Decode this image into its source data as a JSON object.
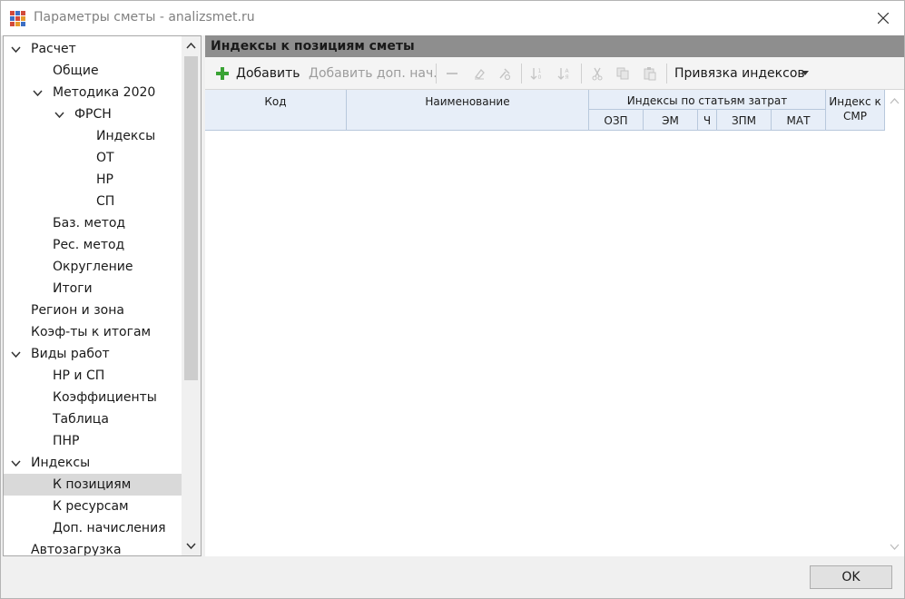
{
  "window": {
    "title": "Параметры сметы - analizsmet.ru"
  },
  "tree": {
    "items": [
      {
        "label": "Расчет",
        "expanded": true
      },
      {
        "label": "Общие"
      },
      {
        "label": "Методика 2020",
        "expanded": true
      },
      {
        "label": "ФРСН",
        "expanded": true
      },
      {
        "label": "Индексы"
      },
      {
        "label": "ОТ"
      },
      {
        "label": "НР"
      },
      {
        "label": "СП"
      },
      {
        "label": "Баз. метод"
      },
      {
        "label": "Рес. метод"
      },
      {
        "label": "Округление"
      },
      {
        "label": "Итоги"
      },
      {
        "label": "Регион и зона"
      },
      {
        "label": "Коэф-ты к итогам"
      },
      {
        "label": "Виды работ",
        "expanded": true
      },
      {
        "label": "НР и СП"
      },
      {
        "label": "Коэффициенты"
      },
      {
        "label": "Таблица"
      },
      {
        "label": "ПНР"
      },
      {
        "label": "Индексы",
        "expanded": true
      },
      {
        "label": "К позициям",
        "selected": true
      },
      {
        "label": "К ресурсам"
      },
      {
        "label": "Доп. начисления"
      },
      {
        "label": "Автозагрузка"
      }
    ]
  },
  "panel": {
    "header": "Индексы к позициям сметы",
    "toolbar": {
      "add_label": "Добавить",
      "add_extra_label": "Добавить доп. нач.",
      "binding_label": "Привязка индексов"
    },
    "grid": {
      "col_code": "Код",
      "col_name": "Наименование",
      "col_group": "Индексы по статьям затрат",
      "col_ozp": "ОЗП",
      "col_em": "ЭМ",
      "col_ch": "Ч",
      "col_zpm": "ЗПМ",
      "col_mat": "МАТ",
      "col_smr_line1": "Индекс к",
      "col_smr_line2": "СМР",
      "rows": []
    }
  },
  "footer": {
    "ok_label": "OK"
  },
  "colors": {
    "panel_header_bg": "#8e8e8e",
    "selection_bg": "#d9d9d9",
    "grid_header_bg": "#e7eef8",
    "add_icon": "#3aa335"
  }
}
